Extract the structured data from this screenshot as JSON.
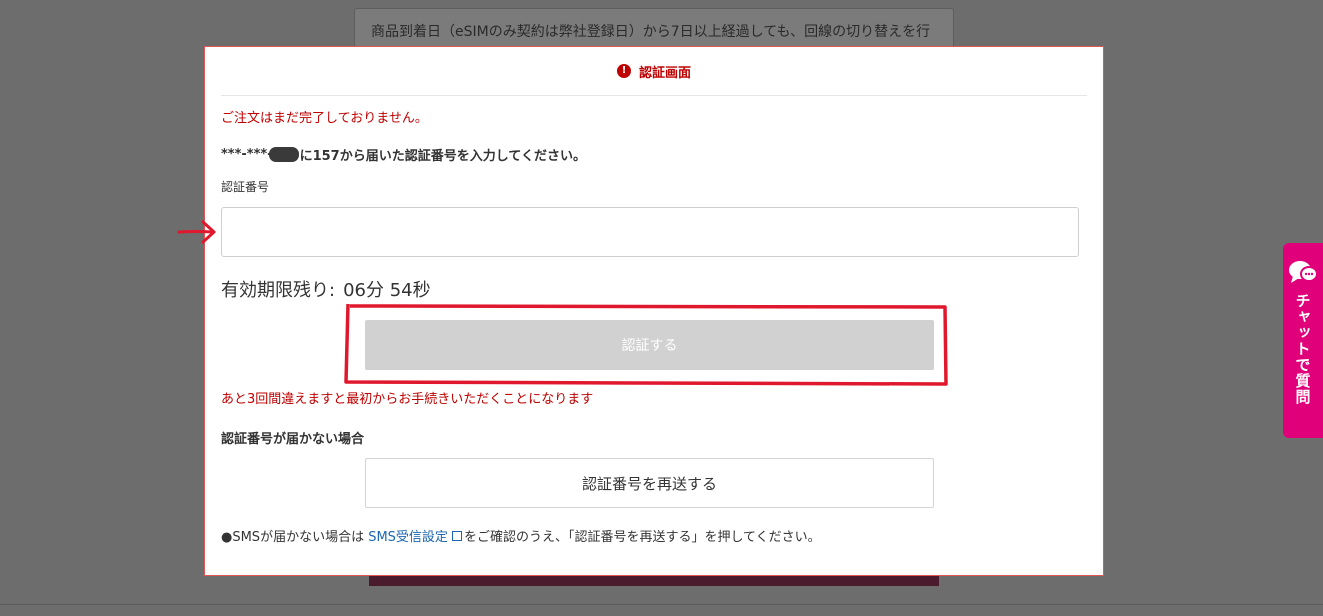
{
  "background": {
    "notice_text": "商品到着日（eSIMのみ契約は弊社登録日）から7日以上経過しても、回線の切り替えを行"
  },
  "modal": {
    "title": "認証画面",
    "order_incomplete": "ご注文はまだ完了しておりません。",
    "instruction_prefix": "***-***-",
    "instruction_suffix": "に157から届いた認証番号を入力してください。",
    "code_label": "認証番号",
    "code_value": "",
    "timer_label": "有効期限残り:",
    "timer_value": "06分 54秒",
    "verify_button": "認証する",
    "attempts_warning": "あと3回間違えますと最初からお手続きいただくことになります",
    "not_received_heading": "認証番号が届かない場合",
    "resend_button": "認証番号を再送する",
    "sms_note_prefix": "●SMSが届かない場合は ",
    "sms_link": "SMS受信設定",
    "sms_note_suffix": "をご確認のうえ、「認証番号を再送する」を押してください。"
  },
  "chat_tab": {
    "label": "チャットで質問",
    "icon": "chat-bubble-icon"
  },
  "colors": {
    "accent_red": "#bf0000",
    "chat_pink": "#e0007a",
    "link_blue": "#1a66b0",
    "annotation_red": "#e0182e",
    "disabled_button": "#d1d1d1"
  }
}
